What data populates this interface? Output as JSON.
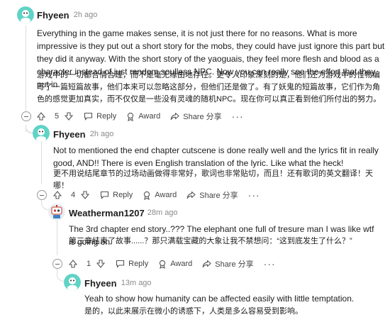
{
  "comments": [
    {
      "id": "c1",
      "username": "Fhyeen",
      "age": "2h ago",
      "text_en": "Everything in the game makes sense, it is not just there for no reasons. What is more impressive is they put out a short story for the mobs, they could have just ignore this part but they did it anyway. With the short story of the yaoguais, they feel more flesh and blood as a character instead of just random soulless NPC. Now you can really see the effort that they put in",
      "text_zh": "游戏中的一切都合情合理，而不是毫无缘由地存在。更令人印象深刻的是，他们还为游戏中的怪物编写了一篇短篇故事，他们本来可以忽略这部分，但他们还是做了。有了妖鬼的短篇故事，它们作为角色的感觉更加真实，而不仅仅是一些没有灵魂的随机NPC。现在你可以真正看到他们所付出的努力。",
      "votes": "5"
    },
    {
      "id": "c2",
      "username": "Fhyeen",
      "age": "2h ago",
      "text_en": "Not to mentioned the end chapter cutscene is done really well and the lyrics fit in really good, AND!! There is even English translation of the lyric. Like what the heck!",
      "text_zh": "更不用说结尾章节的过场动画做得非常好，歌词也非常贴切，而且！还有歌词的英文翻译！天哪！",
      "votes": "4"
    },
    {
      "id": "c3",
      "username": "Weatherman1207",
      "age": "28m ago",
      "text_en": "The 3rd chapter end story..??? The elephant one full of tresure man I was like wtf is going on",
      "text_zh": "第三章结束了故事......？那只满载宝藏的大象让我不禁想问：“这到底发生了什么？”",
      "votes": "1"
    },
    {
      "id": "c4",
      "username": "Fhyeen",
      "age": "13m ago",
      "text_en": "Yeah to show how humanity can be affected easily with little temptation.",
      "text_zh": "是的，以此来展示在微小的诱惑下，人类是多么容易受到影响。"
    }
  ],
  "actions": {
    "reply": "Reply",
    "award": "Award",
    "share": "Share 分享"
  },
  "separator": "·",
  "colors": {
    "avatar_teal": "#5fd3c6",
    "thread_line": "#dcdcdc",
    "meta_gray": "#8a8a8a"
  }
}
